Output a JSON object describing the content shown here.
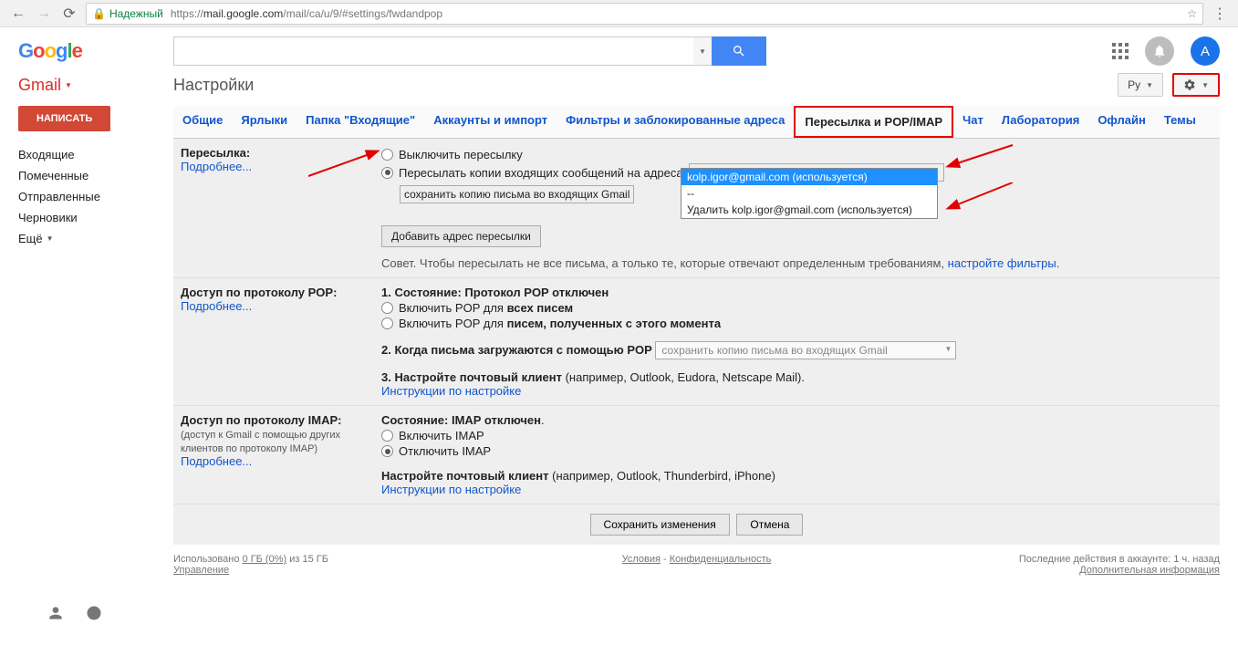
{
  "browser": {
    "secure_label": "Надежный",
    "url_prefix": "https://",
    "url_host": "mail.google.com",
    "url_path": "/mail/ca/u/9/#settings/fwdandpop"
  },
  "header": {
    "avatar_letter": "А",
    "gmail_label": "Gmail",
    "page_title": "Настройки",
    "lang_btn": "Ру"
  },
  "sidebar": {
    "compose": "НАПИСАТЬ",
    "items": [
      "Входящие",
      "Помеченные",
      "Отправленные",
      "Черновики"
    ],
    "more": "Ещё"
  },
  "tabs": [
    "Общие",
    "Ярлыки",
    "Папка \"Входящие\"",
    "Аккаунты и импорт",
    "Фильтры и заблокированные адреса",
    "Пересылка и POP/IMAP",
    "Чат",
    "Лаборатория",
    "Офлайн",
    "Темы"
  ],
  "fwd": {
    "label": "Пересылка:",
    "learn_more": "Подробнее...",
    "opt_disable": "Выключить пересылку",
    "opt_forward": "Пересылать копии входящих сообщений на адреса",
    "selected_addr": "kolp.igor@gmail.com (используется)",
    "keep_copy": "сохранить копию письма во входящих Gmail",
    "dd_options": [
      "kolp.igor@gmail.com (используется)",
      "--",
      "Удалить kolp.igor@gmail.com (используется)"
    ],
    "add_btn": "Добавить адрес пересылки",
    "tip_prefix": "Совет. Чтобы пересылать не все письма, а только те, которые отвечают определенным требованиям, ",
    "tip_link": "настройте фильтры",
    "tip_suffix": "."
  },
  "pop": {
    "label": "Доступ по протоколу POP:",
    "learn_more": "Подробнее...",
    "status_num": "1. Состояние: ",
    "status_val": "Протокол POP отключен",
    "opt_all_prefix": "Включить POP для ",
    "opt_all_bold": "всех писем",
    "opt_new_prefix": "Включить POP для ",
    "opt_new_bold": "писем, полученных с этого момента",
    "q2": "2. Когда письма загружаются с помощью POP",
    "q2_select": "сохранить копию письма во входящих Gmail",
    "q3_prefix": "3. Настройте почтовый клиент ",
    "q3_paren": "(например, Outlook, Eudora, Netscape Mail).",
    "q3_link": "Инструкции по настройке"
  },
  "imap": {
    "label": "Доступ по протоколу IMAP:",
    "sub": "(доступ к Gmail с помощью других клиентов по протоколу IMAP)",
    "learn_more": "Подробнее...",
    "status_prefix": "Состояние: ",
    "status_val": "IMAP отключен",
    "status_dot": ".",
    "opt_on": "Включить IMAP",
    "opt_off": "Отключить IMAP",
    "cfg_prefix": "Настройте почтовый клиент ",
    "cfg_paren": "(например, Outlook, Thunderbird, iPhone)",
    "cfg_link": "Инструкции по настройке"
  },
  "save": {
    "save": "Сохранить изменения",
    "cancel": "Отмена"
  },
  "footer": {
    "usage_prefix": "Использовано ",
    "usage_val": "0 ГБ (0%)",
    "usage_of": " из 15 ГБ",
    "manage": "Управление",
    "terms": "Условия",
    "dash": " - ",
    "privacy": "Конфиденциальность",
    "activity": "Последние действия в аккаунте: 1 ч. назад",
    "details": "Дополнительная информация"
  }
}
